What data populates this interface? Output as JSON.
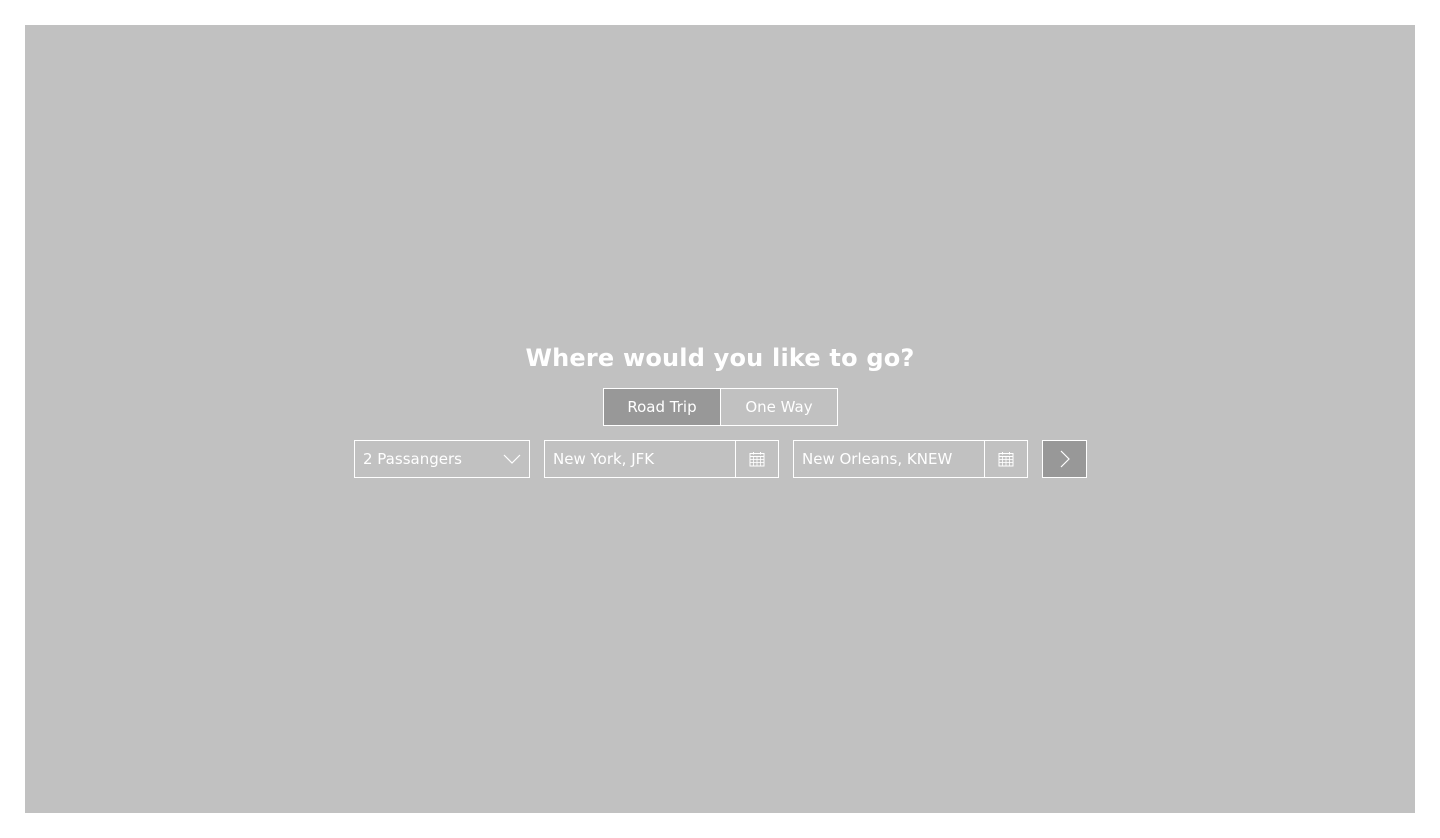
{
  "hero": {
    "title": "Where would you like to go?",
    "background_color": "#c1c1c1"
  },
  "trip_type": {
    "options": [
      {
        "label": "Road Trip",
        "active": true
      },
      {
        "label": "One Way",
        "active": false
      }
    ],
    "active_color": "#989898"
  },
  "search": {
    "passengers": {
      "value": "2 Passangers",
      "icon": "chevron-down-icon"
    },
    "origin": {
      "value": "New York, JFK",
      "icon": "calendar-icon"
    },
    "destination": {
      "value": "New Orleans, KNEW",
      "icon": "calendar-icon"
    },
    "submit": {
      "icon": "chevron-right-icon"
    }
  }
}
